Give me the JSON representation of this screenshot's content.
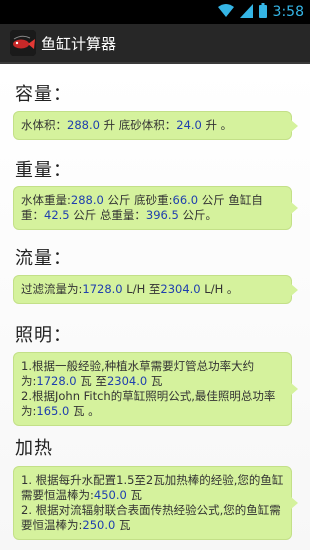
{
  "status": {
    "time": "3:58"
  },
  "app": {
    "title": "鱼缸计算器",
    "icon": "fish-icon"
  },
  "sections": {
    "capacity": {
      "heading": "容量：",
      "water_label": "水体积：",
      "water_value": "288.0",
      "water_unit": "升 底砂体积：",
      "sand_value": "24.0",
      "sand_unit": "升 。"
    },
    "weight": {
      "heading": "重量：",
      "p1": "水体重量:",
      "water_value": "288.0",
      "p2": "公斤 底砂重:",
      "sand_value": "66.0",
      "p3": "公斤 鱼缸自重：",
      "tank_value": "42.5",
      "p4": "公斤 总重量：",
      "total_value": "396.5",
      "p5": "公斤。"
    },
    "flow": {
      "heading": "流量：",
      "p1": "过滤流量为:",
      "min_value": "1728.0",
      "p2": "L/H 至",
      "max_value": "2304.0",
      "p3": "L/H 。"
    },
    "lighting": {
      "heading": "照明：",
      "l1": "1.根据一般经验,种植水草需要灯管总功率大约为:",
      "min_value": "1728.0",
      "l1b": "瓦 至",
      "max_value": "2304.0",
      "l1c": "瓦",
      "l2": "2.根据John Fitch的草缸照明公式,最佳照明总功率为:",
      "fitch_value": "165.0",
      "l2b": "瓦 。"
    },
    "heating": {
      "heading": "加热",
      "l1": "1. 根据每升水配置1.5至2瓦加热棒的经验,您的鱼缸需要恒温棒为:",
      "v1": "450.0",
      "l1b": "瓦",
      "l2": "2. 根据对流辐射联合表面传热经验公式,您的鱼缸需要恒温棒为:",
      "v2": "250.0",
      "l2b": "瓦"
    }
  }
}
